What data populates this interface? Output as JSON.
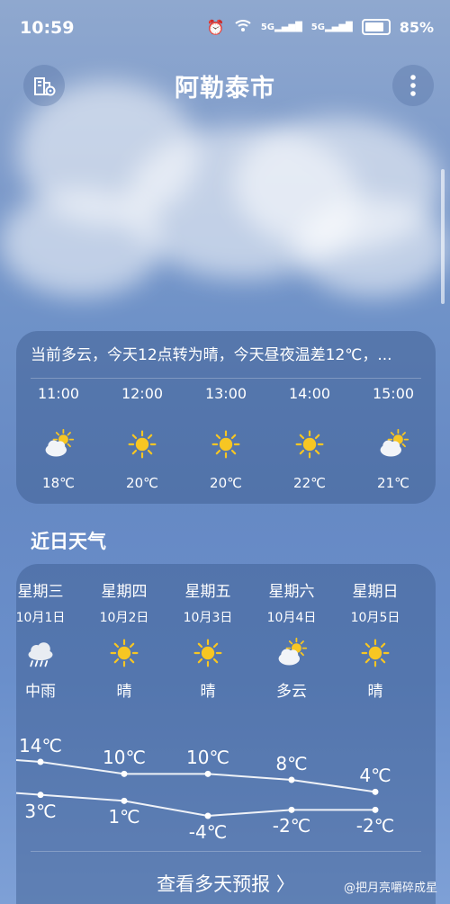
{
  "status": {
    "time": "10:59",
    "signal1": "5G",
    "signal2": "5G",
    "battery": "85%"
  },
  "header": {
    "city": "阿勒泰市"
  },
  "hourly": {
    "summary": "当前多云，今天12点转为晴，今天昼夜温差12℃，...",
    "items": [
      {
        "time": "11:00",
        "icon": "partly-cloudy-icon",
        "temp": "18℃"
      },
      {
        "time": "12:00",
        "icon": "sun-icon",
        "temp": "20℃"
      },
      {
        "time": "13:00",
        "icon": "sun-icon",
        "temp": "20℃"
      },
      {
        "time": "14:00",
        "icon": "sun-icon",
        "temp": "22℃"
      },
      {
        "time": "15:00",
        "icon": "partly-cloudy-icon",
        "temp": "21℃"
      }
    ]
  },
  "daily": {
    "title": "近日天气",
    "days": [
      {
        "weekday": "星期三",
        "date": "10月1日",
        "icon": "rain-icon",
        "condition": "中雨",
        "high": "14℃",
        "low": "3℃"
      },
      {
        "weekday": "星期四",
        "date": "10月2日",
        "icon": "sun-icon",
        "condition": "晴",
        "high": "10℃",
        "low": "1℃"
      },
      {
        "weekday": "星期五",
        "date": "10月3日",
        "icon": "sun-icon",
        "condition": "晴",
        "high": "10℃",
        "low": "-4℃"
      },
      {
        "weekday": "星期六",
        "date": "10月4日",
        "icon": "partly-cloudy-icon",
        "condition": "多云",
        "high": "8℃",
        "low": "-2℃"
      },
      {
        "weekday": "星期日",
        "date": "10月5日",
        "icon": "sun-icon",
        "condition": "晴",
        "high": "4℃",
        "low": "-2℃"
      }
    ],
    "more_label": "查看多天预报 〉"
  },
  "watermark": "@把月亮嚼碎成星",
  "colors": {
    "sun": "#f7c623",
    "cloud": "#f2f4f8",
    "rain_cloud": "#e8ecf2"
  }
}
